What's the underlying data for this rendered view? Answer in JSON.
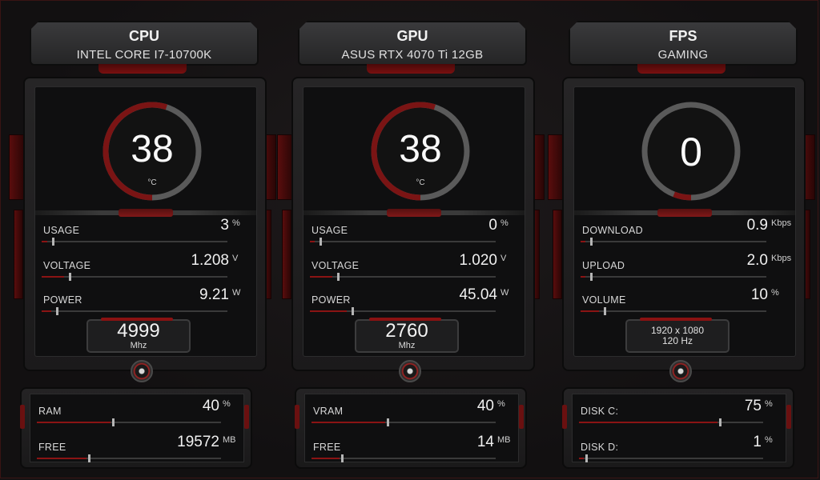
{
  "colors": {
    "accent": "#8a1414",
    "gauge_arc": "#7a1414",
    "background": "#141213"
  },
  "panels": [
    {
      "title": "CPU",
      "subtitle": "INTEL CORE I7-10700K",
      "gauge": {
        "value": "38",
        "unit": "°C",
        "fraction": 0.55
      },
      "metrics": [
        {
          "label": "USAGE",
          "value": "3",
          "unit": "%",
          "level": 0.03
        },
        {
          "label": "VOLTAGE",
          "value": "1.208",
          "unit": "V",
          "level": 0.12
        },
        {
          "label": "POWER",
          "value": "9.21",
          "unit": "W",
          "level": 0.05
        }
      ],
      "freq": {
        "value": "4999",
        "unit": "Mhz"
      },
      "bottom": [
        {
          "label": "RAM",
          "value": "40",
          "unit": "%",
          "level": 0.4
        },
        {
          "label": "FREE",
          "value": "19572",
          "unit": "MB",
          "level": 0.27
        }
      ]
    },
    {
      "title": "GPU",
      "subtitle": "ASUS RTX 4070 Ti 12GB",
      "gauge": {
        "value": "38",
        "unit": "°C",
        "fraction": 0.55
      },
      "metrics": [
        {
          "label": "USAGE",
          "value": "0",
          "unit": "%",
          "level": 0.0
        },
        {
          "label": "VOLTAGE",
          "value": "1.020",
          "unit": "V",
          "level": 0.12
        },
        {
          "label": "POWER",
          "value": "45.04",
          "unit": "W",
          "level": 0.2
        }
      ],
      "freq": {
        "value": "2760",
        "unit": "Mhz"
      },
      "bottom": [
        {
          "label": "VRAM",
          "value": "40",
          "unit": "%",
          "level": 0.4
        },
        {
          "label": "FREE",
          "value": "14",
          "unit": "MB",
          "level": 0.15
        }
      ]
    },
    {
      "title": "FPS",
      "subtitle": "GAMING",
      "gauge": {
        "value": "0",
        "unit": "",
        "fraction": 0.06
      },
      "metrics": [
        {
          "label": "DOWNLOAD",
          "value": "0.9",
          "unit": "Kbps",
          "level": 0.0
        },
        {
          "label": "UPLOAD",
          "value": "2.0",
          "unit": "Kbps",
          "level": 0.01
        },
        {
          "label": "VOLUME",
          "value": "10",
          "unit": "%",
          "level": 0.1
        }
      ],
      "resolution": {
        "size": "1920 x 1080",
        "rate": "120 Hz"
      },
      "bottom": [
        {
          "label": "DISK C:",
          "value": "75",
          "unit": "%",
          "level": 0.75
        },
        {
          "label": "DISK D:",
          "value": "1",
          "unit": "%",
          "level": 0.01
        }
      ]
    }
  ]
}
